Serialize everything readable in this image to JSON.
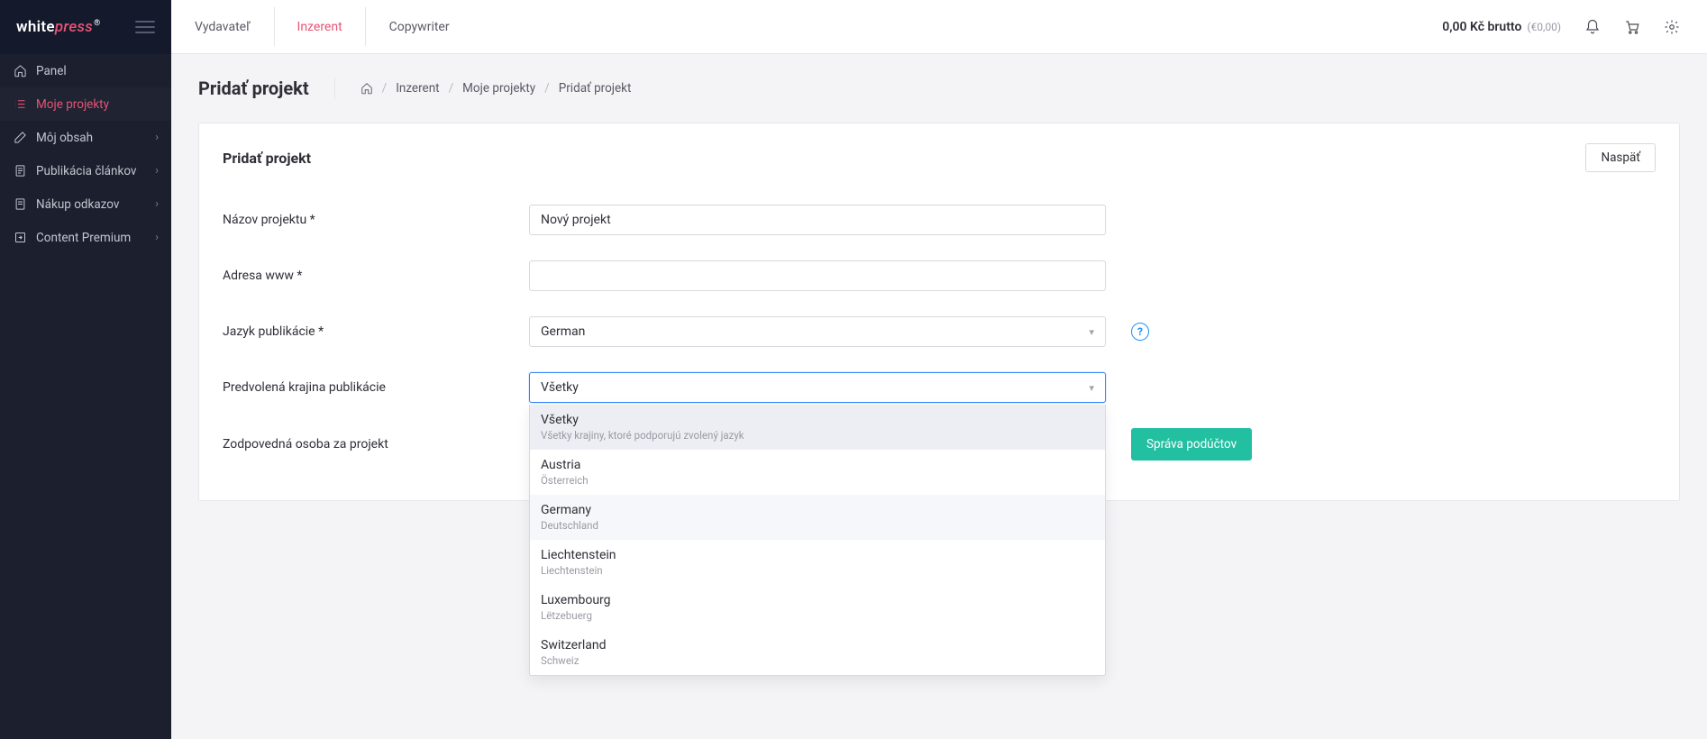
{
  "brand": {
    "part1": "white",
    "part2": "press",
    "reg": "®"
  },
  "sidebar": {
    "items": [
      {
        "label": "Panel",
        "icon": "home"
      },
      {
        "label": "Moje projekty",
        "icon": "list",
        "active": true
      },
      {
        "label": "Môj obsah",
        "icon": "edit",
        "chevron": true
      },
      {
        "label": "Publikácia článkov",
        "icon": "doc",
        "chevron": true
      },
      {
        "label": "Nákup odkazov",
        "icon": "doc",
        "chevron": true
      },
      {
        "label": "Content Premium",
        "icon": "ext",
        "chevron": true
      }
    ]
  },
  "topnav": {
    "tabs": [
      {
        "label": "Vydavateľ"
      },
      {
        "label": "Inzerent",
        "active": true
      },
      {
        "label": "Copywriter"
      }
    ],
    "balance_main": "0,00 Kč brutto",
    "balance_sub": "(€0,00)"
  },
  "page": {
    "title": "Pridať projekt",
    "crumb1": "Inzerent",
    "crumb2": "Moje projekty",
    "crumb3": "Pridať projekt"
  },
  "card": {
    "title": "Pridať projekt",
    "back_label": "Naspäť"
  },
  "form": {
    "name_label": "Názov projektu *",
    "name_value": "Nový projekt",
    "www_label": "Adresa www *",
    "www_value": "",
    "lang_label": "Jazyk publikácie *",
    "lang_value": "German",
    "country_label": "Predvolená krajina publikácie",
    "country_value": "Všetky",
    "owner_label": "Zodpovedná osoba za projekt",
    "manage_btn": "Správa podúčtov",
    "info_glyph": "?"
  },
  "dropdown": {
    "options": [
      {
        "title": "Všetky",
        "sub": "Všetky krajiny, ktoré podporujú zvolený jazyk",
        "selected": true
      },
      {
        "title": "Austria",
        "sub": "Österreich"
      },
      {
        "title": "Germany",
        "sub": "Deutschland",
        "light": true
      },
      {
        "title": "Liechtenstein",
        "sub": "Liechtenstein"
      },
      {
        "title": "Luxembourg",
        "sub": "Lëtzebuerg"
      },
      {
        "title": "Switzerland",
        "sub": "Schweiz"
      }
    ]
  }
}
